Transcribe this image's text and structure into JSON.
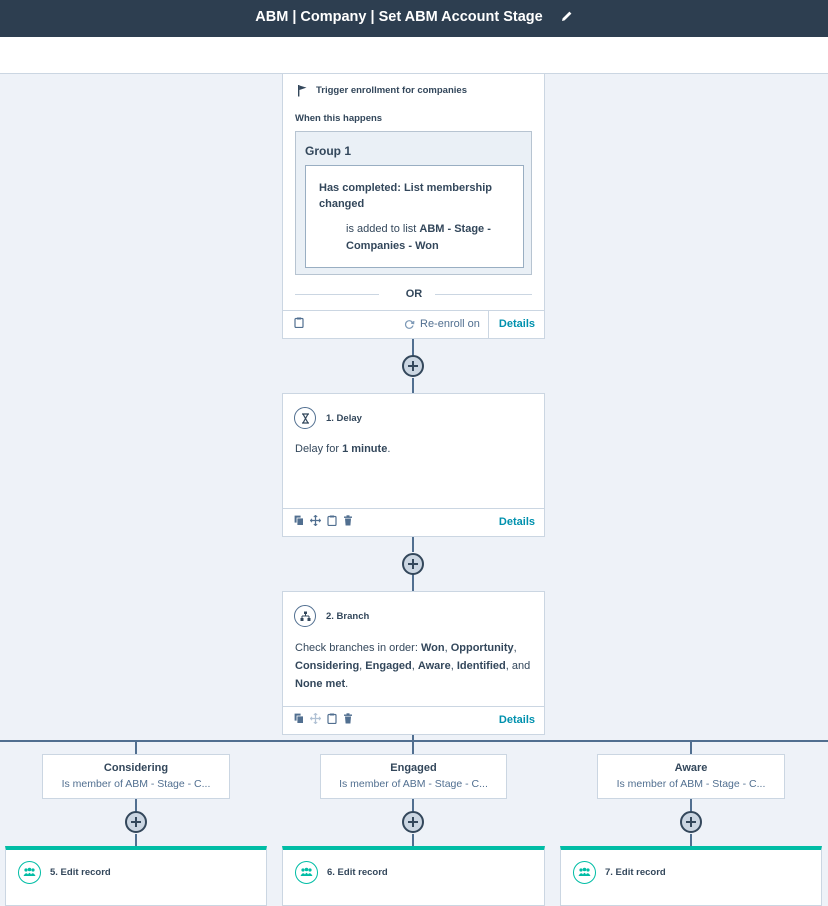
{
  "header": {
    "title": "ABM | Company | Set ABM Account Stage"
  },
  "trigger": {
    "heading": "Trigger enrollment for companies",
    "when": "When this happens",
    "group_title": "Group 1",
    "condition_title": "Has completed: List membership changed",
    "condition_prefix": "is added to list ",
    "condition_list": "ABM - Stage - Companies - Won",
    "or_label": "OR",
    "reenroll": "Re-enroll on",
    "details": "Details"
  },
  "delay": {
    "label": "1. Delay",
    "text_prefix": "Delay for ",
    "duration": "1 minute",
    "text_suffix": ".",
    "details": "Details"
  },
  "branch": {
    "label": "2. Branch",
    "intro": "Check branches in order: ",
    "branches": [
      "Won",
      "Opportunity",
      "Considering",
      "Engaged",
      "Aware",
      "Identified"
    ],
    "joiner_and": "and ",
    "none_met": "None met",
    "details": "Details"
  },
  "branches_visible": [
    {
      "title": "Considering",
      "subtitle": "Is member of ABM - Stage - C..."
    },
    {
      "title": "Engaged",
      "subtitle": "Is member of ABM - Stage - C..."
    },
    {
      "title": "Aware",
      "subtitle": "Is member of ABM - Stage - C..."
    }
  ],
  "edit_records": [
    {
      "label": "5. Edit record"
    },
    {
      "label": "6. Edit record"
    },
    {
      "label": "7. Edit record"
    }
  ],
  "colors": {
    "topbar": "#2d3e50",
    "canvas": "#eef2f8",
    "accent_teal": "#00bda5",
    "link": "#0091ae",
    "line": "#516f90"
  },
  "icons": [
    "pencil-icon",
    "flag-icon",
    "clipboard-icon",
    "refresh-icon",
    "hourglass-icon",
    "copy-icon",
    "move-icon",
    "trash-icon",
    "branch-icon",
    "people-icon",
    "plus-icon"
  ]
}
